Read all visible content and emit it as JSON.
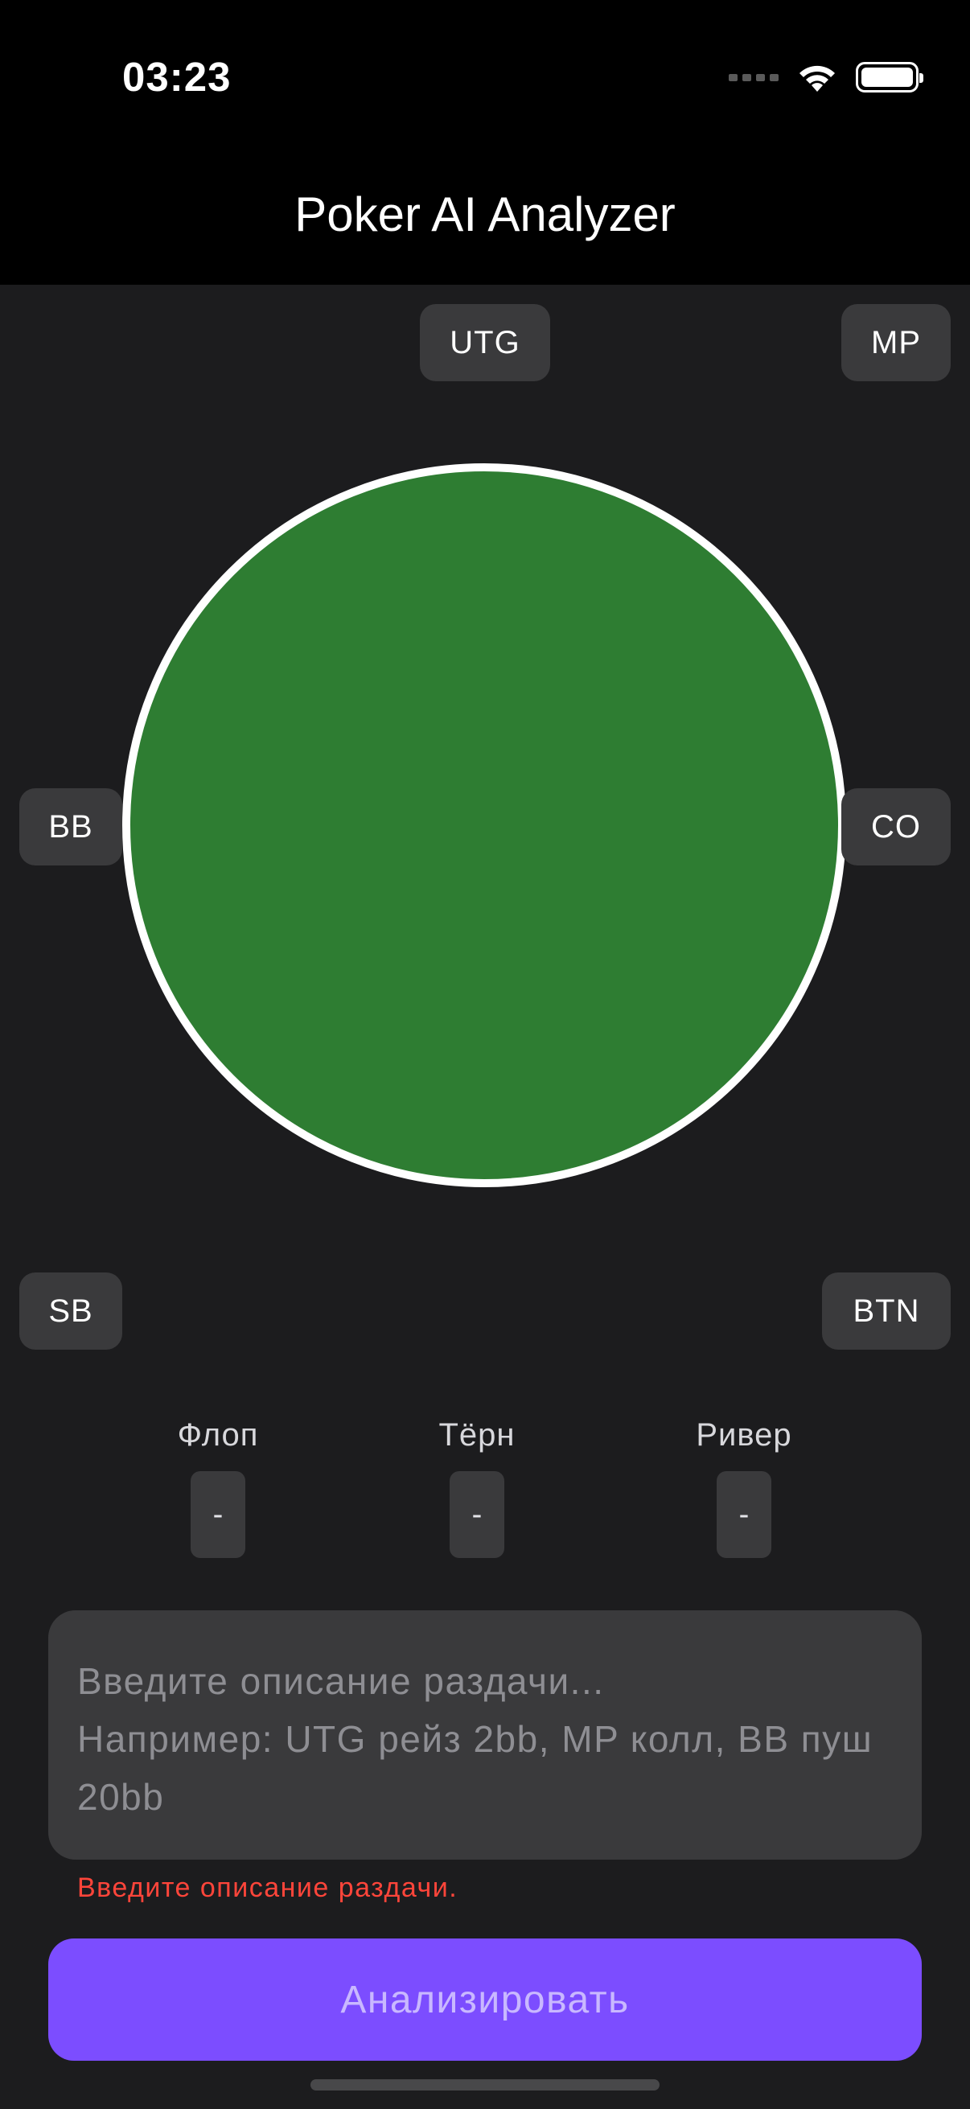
{
  "status_bar": {
    "time": "03:23",
    "icons": [
      "signal-icon",
      "wifi-icon",
      "battery-icon"
    ]
  },
  "header": {
    "title": "Poker AI Analyzer"
  },
  "seats": {
    "utg": "UTG",
    "mp": "MP",
    "bb": "BB",
    "co": "CO",
    "sb": "SB",
    "btn": "BTN"
  },
  "table": {
    "felt_color": "#2e7d32",
    "rail_color": "#ffffff"
  },
  "streets": [
    {
      "label": "Флоп",
      "value": "-"
    },
    {
      "label": "Тёрн",
      "value": "-"
    },
    {
      "label": "Ривер",
      "value": "-"
    }
  ],
  "hand_input": {
    "placeholder": "Введите описание раздачи...\nНапример: UTG рейз 2bb, MP колл, BB пуш 20bb"
  },
  "validation_error": "Введите описание раздачи.",
  "analyze_button": {
    "label": "Анализировать",
    "color": "#7c4dff"
  }
}
